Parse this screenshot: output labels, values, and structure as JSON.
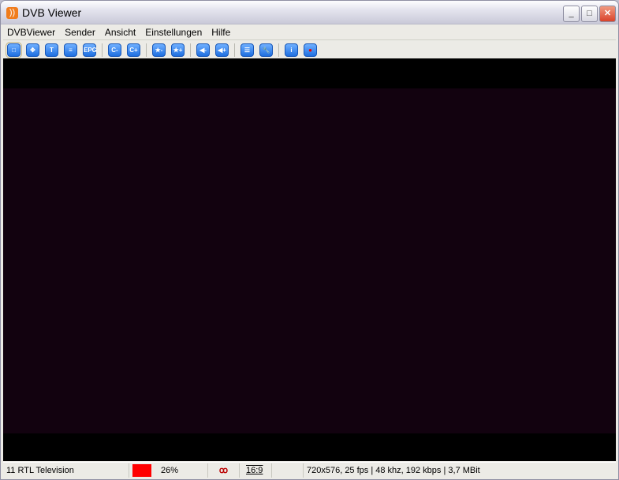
{
  "window": {
    "title": "DVB Viewer",
    "icon": "rss-orange-icon"
  },
  "menu": [
    "DVBViewer",
    "Sender",
    "Ansicht",
    "Einstellungen",
    "Hilfe"
  ],
  "toolbar": [
    {
      "icon": "fullscreen-icon",
      "glyph": "□"
    },
    {
      "icon": "move-icon",
      "glyph": "✥"
    },
    {
      "icon": "teletext-icon",
      "glyph": "T"
    },
    {
      "icon": "osd-list-icon",
      "glyph": "≡"
    },
    {
      "icon": "epg-icon",
      "glyph": "EPG"
    },
    {
      "icon": "channel-down-icon",
      "glyph": "C-"
    },
    {
      "icon": "channel-up-icon",
      "glyph": "C+"
    },
    {
      "icon": "favorite-down-icon",
      "glyph": "★-"
    },
    {
      "icon": "favorite-up-icon",
      "glyph": "★+"
    },
    {
      "icon": "volume-down-icon",
      "glyph": "◀-"
    },
    {
      "icon": "volume-up-icon",
      "glyph": "◀+"
    },
    {
      "icon": "channel-list-icon",
      "glyph": "☰"
    },
    {
      "icon": "settings-wrench-icon",
      "glyph": "🔧"
    },
    {
      "icon": "info-icon",
      "glyph": "i"
    },
    {
      "icon": "record-icon",
      "glyph": "●"
    }
  ],
  "status": {
    "channel": "11 RTL Television",
    "signal_color": "#ff0000",
    "signal": "26%",
    "dolby_icon": "dolby-icon",
    "aspect": "16:9",
    "stream_info": "720x576, 25 fps | 48 khz, 192 kbps | 3,7 MBit"
  }
}
